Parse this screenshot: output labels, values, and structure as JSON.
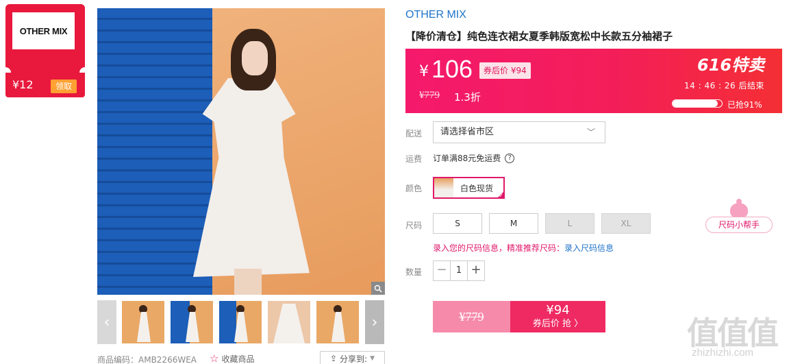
{
  "coupon": {
    "brand_logo": "OTHER MIX",
    "value": "¥12",
    "claim_label": "领取",
    "color": "#e8193c"
  },
  "gallery": {
    "thumbnail_count": 5,
    "product_code": "商品编码：AMB2266WEA",
    "favorite_label": "收藏商品",
    "share_label": "分享到:"
  },
  "product": {
    "brand": "OTHER MIX",
    "title": "【降价清仓】纯色连衣裙女夏季韩版宽松中长款五分袖裙子"
  },
  "price": {
    "currency": "¥",
    "current": "106",
    "after_coupon_tag": "券后价 ¥94",
    "original": "¥779",
    "discount": "1.3折",
    "promo_title": "616特卖",
    "countdown": "14 : 46 : 26  后结束",
    "sold_percent": 0.91,
    "sold_text": "已抢91%"
  },
  "delivery": {
    "label": "配送",
    "placeholder": "请选择省市区"
  },
  "freight": {
    "label": "运费",
    "text": "订单满88元免运费"
  },
  "color": {
    "label": "颜色",
    "selected": "白色现货"
  },
  "size": {
    "label": "尺码",
    "options": [
      "S",
      "M",
      "L",
      "XL"
    ],
    "disabled": [
      "L",
      "XL"
    ],
    "helper": "尺码小帮手",
    "tip": "录入您的尺码信息，精准推荐尺码：",
    "tip_link": "录入尺码信息"
  },
  "quantity": {
    "label": "数量",
    "value": "1",
    "minus": "−",
    "plus": "+"
  },
  "buy": {
    "original": "¥779",
    "coupon_price": "¥94",
    "coupon_label": "券后价 抢 〉"
  },
  "watermark": {
    "logo": "值值值",
    "url": "zhizhizhi.com"
  },
  "colors": {
    "accent": "#e0176a",
    "link": "#1f73c8",
    "price_bar": "#f31e59"
  }
}
